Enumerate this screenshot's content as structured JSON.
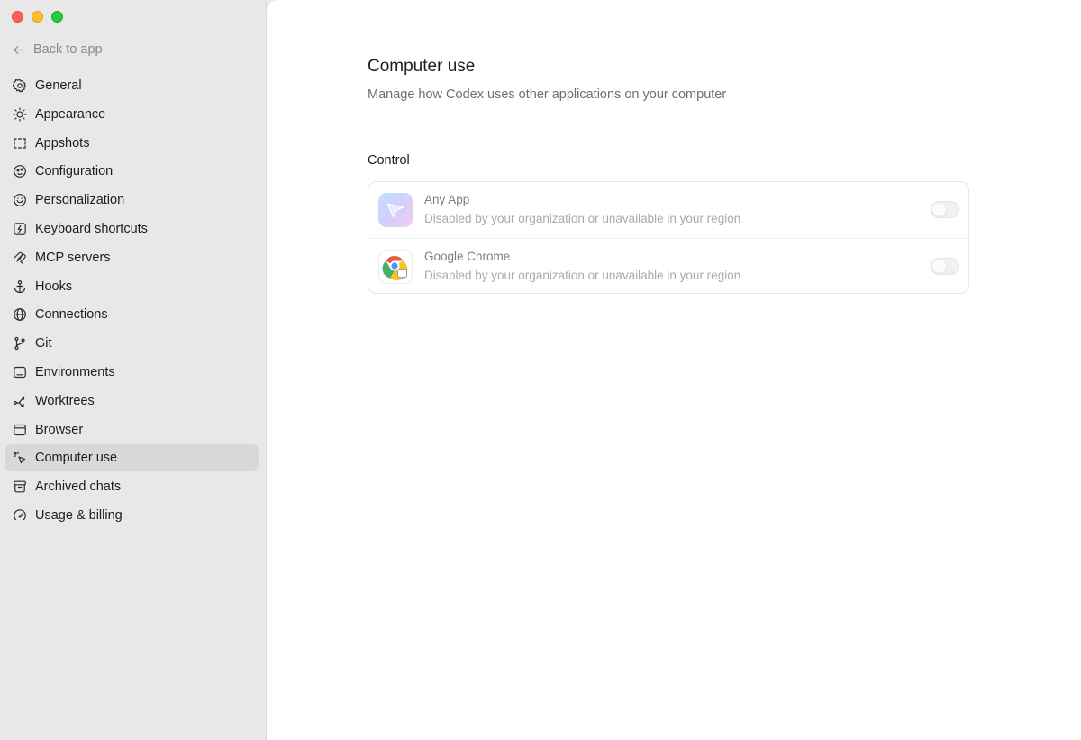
{
  "sidebar": {
    "back_label": "Back to app",
    "items": [
      {
        "label": "General",
        "icon": "gear-icon"
      },
      {
        "label": "Appearance",
        "icon": "sun-icon"
      },
      {
        "label": "Appshots",
        "icon": "capture-icon"
      },
      {
        "label": "Configuration",
        "icon": "config-icon"
      },
      {
        "label": "Personalization",
        "icon": "personalization-icon"
      },
      {
        "label": "Keyboard shortcuts",
        "icon": "keyboard-icon"
      },
      {
        "label": "MCP servers",
        "icon": "mcp-icon"
      },
      {
        "label": "Hooks",
        "icon": "anchor-icon"
      },
      {
        "label": "Connections",
        "icon": "globe-icon"
      },
      {
        "label": "Git",
        "icon": "git-branch-icon"
      },
      {
        "label": "Environments",
        "icon": "laptop-icon"
      },
      {
        "label": "Worktrees",
        "icon": "worktree-icon"
      },
      {
        "label": "Browser",
        "icon": "browser-icon"
      },
      {
        "label": "Computer use",
        "icon": "cursor-click-icon",
        "active": true
      },
      {
        "label": "Archived chats",
        "icon": "archive-icon"
      },
      {
        "label": "Usage & billing",
        "icon": "gauge-icon"
      }
    ]
  },
  "main": {
    "title": "Computer use",
    "subtitle": "Manage how Codex uses other applications on your computer",
    "section_label": "Control",
    "rows": [
      {
        "title": "Any App",
        "description": "Disabled by your organization or unavailable in your region",
        "icon": "any-app-icon",
        "enabled": false
      },
      {
        "title": "Google Chrome",
        "description": "Disabled by your organization or unavailable in your region",
        "icon": "chrome-icon",
        "enabled": false
      }
    ]
  },
  "colors": {
    "sidebar_bg": "#e8e8e9",
    "active_item_bg": "#d8d8da",
    "close": "#fe5f57",
    "minimize": "#febc2e",
    "zoom": "#28c840"
  }
}
